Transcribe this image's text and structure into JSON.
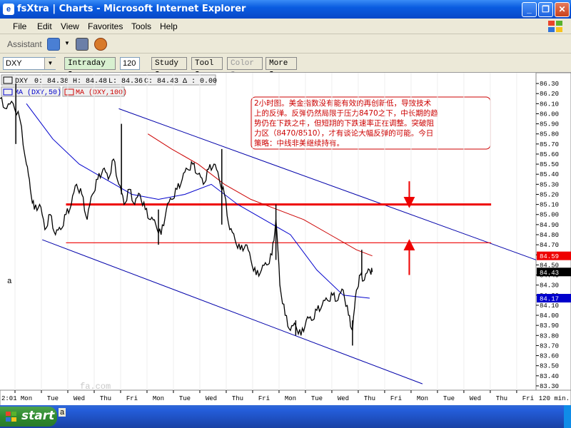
{
  "window": {
    "title": "fsXtra | Charts - Microsoft Internet Explorer",
    "minimize": "_",
    "maximize": "❐",
    "close": "✕"
  },
  "menu": [
    "File",
    "Edit",
    "View",
    "Favorites",
    "Tools",
    "Help"
  ],
  "assistant": {
    "label": "Assistant"
  },
  "toolbar": {
    "symbol": "DXY",
    "interval": "Intraday",
    "bars": "120",
    "study": "Study",
    "tool": "Tool",
    "color": "Color",
    "more": "More"
  },
  "legend": {
    "symbol": "DXY",
    "open": "0: 84.38",
    "high": "H: 84.48",
    "low": "L: 84.36",
    "close": "C: 84.43",
    "change": "Δ : 0.00",
    "ma50": "MA (DXY,50)",
    "ma100": "MA (DXY,100)"
  },
  "annotation": {
    "text": "2小时图。美金指数没有能有效的再创新低，导致技术上的反弹。反弹仍然局限于压力8470之下，中长期的趋势仍在下跌之中，但短期的下跌速率正在调整。突破阻力区（8470/8510），才有谈论大幅反弹的可能。今日策略：中线非美继续持有。",
    "lines": [
      "2小时图。美金指数没有能有效的再创新低，导致技术",
      "上的反弹。反弹仍然局限于压力8470之下，中长期的趋",
      "势仍在下跌之中，但短期的下跌速率正在调整。突破阻",
      "力区（8470/8510），才有谈论大幅反弹的可能。今日",
      "策略：中线非美继续持有。"
    ]
  },
  "side_letter": "a",
  "watermark": "fa.com",
  "taskbar": {
    "start": "start",
    "item": "a"
  },
  "colors": {
    "price": "#000000",
    "ma50": "#0000cc",
    "ma100": "#cc0000",
    "channel": "#0000aa",
    "resistance": "#ee0000",
    "ma100_badge": "#ee0000",
    "ma50_badge": "#0000cc",
    "last_badge": "#000000"
  },
  "chart_data": {
    "type": "line",
    "symbol": "DXY",
    "bar_interval": "2h",
    "x_ticks": [
      "Mon",
      "Tue",
      "Wed",
      "Thu",
      "Fri",
      "Mon",
      "Tue",
      "Wed",
      "Thu",
      "Fri",
      "Mon",
      "Tue",
      "Wed",
      "Thu",
      "Fri",
      "Mon",
      "Tue",
      "Wed",
      "Thu",
      "Fri"
    ],
    "x_left_label": "2:01",
    "x_right_label": "120 min.",
    "y_ticks": [
      83.3,
      83.4,
      83.5,
      83.6,
      83.7,
      83.8,
      83.9,
      84.0,
      84.1,
      84.2,
      84.3,
      84.4,
      84.5,
      84.6,
      84.7,
      84.8,
      84.9,
      85.0,
      85.1,
      85.2,
      85.3,
      85.4,
      85.5,
      85.6,
      85.7,
      85.8,
      85.9,
      86.0,
      86.1,
      86.2,
      86.3
    ],
    "ylim": [
      83.25,
      86.35
    ],
    "xlim": [
      0,
      20.3
    ],
    "price_path": [
      [
        0.0,
        86.15
      ],
      [
        0.25,
        86.05
      ],
      [
        0.5,
        86.1
      ],
      [
        0.75,
        85.95
      ],
      [
        1.0,
        85.5
      ],
      [
        1.15,
        85.25
      ],
      [
        1.3,
        85.05
      ],
      [
        1.5,
        85.1
      ],
      [
        1.7,
        84.85
      ],
      [
        1.9,
        85.0
      ],
      [
        2.1,
        84.8
      ],
      [
        2.3,
        84.85
      ],
      [
        2.5,
        85.0
      ],
      [
        2.7,
        85.1
      ],
      [
        2.9,
        85.3
      ],
      [
        3.1,
        85.2
      ],
      [
        3.3,
        84.95
      ],
      [
        3.5,
        85.2
      ],
      [
        3.7,
        85.35
      ],
      [
        3.9,
        85.45
      ],
      [
        4.1,
        85.35
      ],
      [
        4.3,
        85.55
      ],
      [
        4.5,
        85.3
      ],
      [
        4.7,
        85.1
      ],
      [
        4.9,
        85.25
      ],
      [
        5.1,
        85.1
      ],
      [
        5.3,
        85.2
      ],
      [
        5.5,
        85.05
      ],
      [
        5.7,
        84.95
      ],
      [
        5.9,
        84.9
      ],
      [
        6.1,
        84.8
      ],
      [
        6.3,
        85.05
      ],
      [
        6.5,
        85.15
      ],
      [
        6.7,
        85.25
      ],
      [
        6.9,
        85.35
      ],
      [
        7.1,
        85.45
      ],
      [
        7.3,
        85.5
      ],
      [
        7.5,
        85.4
      ],
      [
        7.7,
        85.3
      ],
      [
        7.9,
        85.45
      ],
      [
        8.1,
        85.5
      ],
      [
        8.3,
        85.35
      ],
      [
        8.5,
        85.2
      ],
      [
        8.7,
        84.85
      ],
      [
        8.9,
        84.75
      ],
      [
        9.1,
        84.65
      ],
      [
        9.3,
        84.7
      ],
      [
        9.5,
        84.55
      ],
      [
        9.7,
        84.4
      ],
      [
        9.9,
        84.45
      ],
      [
        10.1,
        84.5
      ],
      [
        10.3,
        84.6
      ],
      [
        10.45,
        84.95
      ],
      [
        10.6,
        84.3
      ],
      [
        10.8,
        84.0
      ],
      [
        11.0,
        83.85
      ],
      [
        11.2,
        83.9
      ],
      [
        11.4,
        83.8
      ],
      [
        11.6,
        83.95
      ],
      [
        11.8,
        83.95
      ],
      [
        12.0,
        84.05
      ],
      [
        12.2,
        84.1
      ],
      [
        12.4,
        84.15
      ],
      [
        12.6,
        84.2
      ],
      [
        12.8,
        84.15
      ],
      [
        13.0,
        84.25
      ],
      [
        13.2,
        84.0
      ],
      [
        13.35,
        83.85
      ],
      [
        13.5,
        84.25
      ],
      [
        13.65,
        84.4
      ],
      [
        13.8,
        84.35
      ],
      [
        14.0,
        84.45
      ],
      [
        14.1,
        84.43
      ]
    ],
    "price_spikes": [
      [
        0.6,
        85.7,
        86.3
      ],
      [
        4.6,
        85.2,
        85.9
      ],
      [
        6.0,
        84.7,
        85.05
      ],
      [
        8.4,
        84.9,
        85.65
      ],
      [
        10.45,
        84.55,
        85.1
      ],
      [
        11.2,
        83.8,
        83.95
      ],
      [
        13.35,
        83.7,
        83.95
      ],
      [
        13.7,
        84.4,
        84.65
      ]
    ],
    "series": [
      {
        "name": "MA (DXY,50)",
        "points": [
          [
            1.0,
            86.1
          ],
          [
            2.0,
            85.75
          ],
          [
            3.0,
            85.5
          ],
          [
            4.0,
            85.35
          ],
          [
            5.0,
            85.2
          ],
          [
            6.0,
            85.15
          ],
          [
            7.0,
            85.2
          ],
          [
            8.0,
            85.3
          ],
          [
            9.0,
            85.1
          ],
          [
            10.0,
            84.95
          ],
          [
            11.0,
            84.8
          ],
          [
            12.0,
            84.45
          ],
          [
            13.0,
            84.2
          ],
          [
            14.0,
            84.17
          ]
        ]
      },
      {
        "name": "MA (DXY,100)",
        "points": [
          [
            5.6,
            85.8
          ],
          [
            6.5,
            85.65
          ],
          [
            7.5,
            85.5
          ],
          [
            8.5,
            85.3
          ],
          [
            9.5,
            85.15
          ],
          [
            10.5,
            85.05
          ],
          [
            11.5,
            84.95
          ],
          [
            12.5,
            84.8
          ],
          [
            13.5,
            84.65
          ],
          [
            14.1,
            84.59
          ]
        ]
      }
    ],
    "trendlines": [
      {
        "kind": "channel_upper",
        "from": [
          4.5,
          86.05
        ],
        "to": [
          20.3,
          84.55
        ]
      },
      {
        "kind": "channel_lower",
        "from": [
          1.6,
          84.75
        ],
        "to": [
          16.0,
          83.32
        ]
      },
      {
        "kind": "resistance",
        "level": 85.1,
        "from": [
          2.5,
          85.1
        ],
        "to": [
          18.6,
          85.1
        ]
      },
      {
        "kind": "resistance",
        "level": 84.7,
        "from": [
          2.5,
          84.72
        ],
        "to": [
          18.6,
          84.72
        ]
      }
    ],
    "arrows": [
      {
        "direction": "down",
        "x": 15.5,
        "from": 85.33,
        "to": 85.12
      },
      {
        "direction": "up",
        "x": 15.5,
        "from": 84.4,
        "to": 84.7
      }
    ],
    "value_badges": [
      {
        "label": "84.59",
        "value": 84.59,
        "series": "MA (DXY,100)"
      },
      {
        "label": "84.43",
        "value": 84.43,
        "series": "price"
      },
      {
        "label": "84.17",
        "value": 84.17,
        "series": "MA (DXY,50)"
      }
    ]
  }
}
